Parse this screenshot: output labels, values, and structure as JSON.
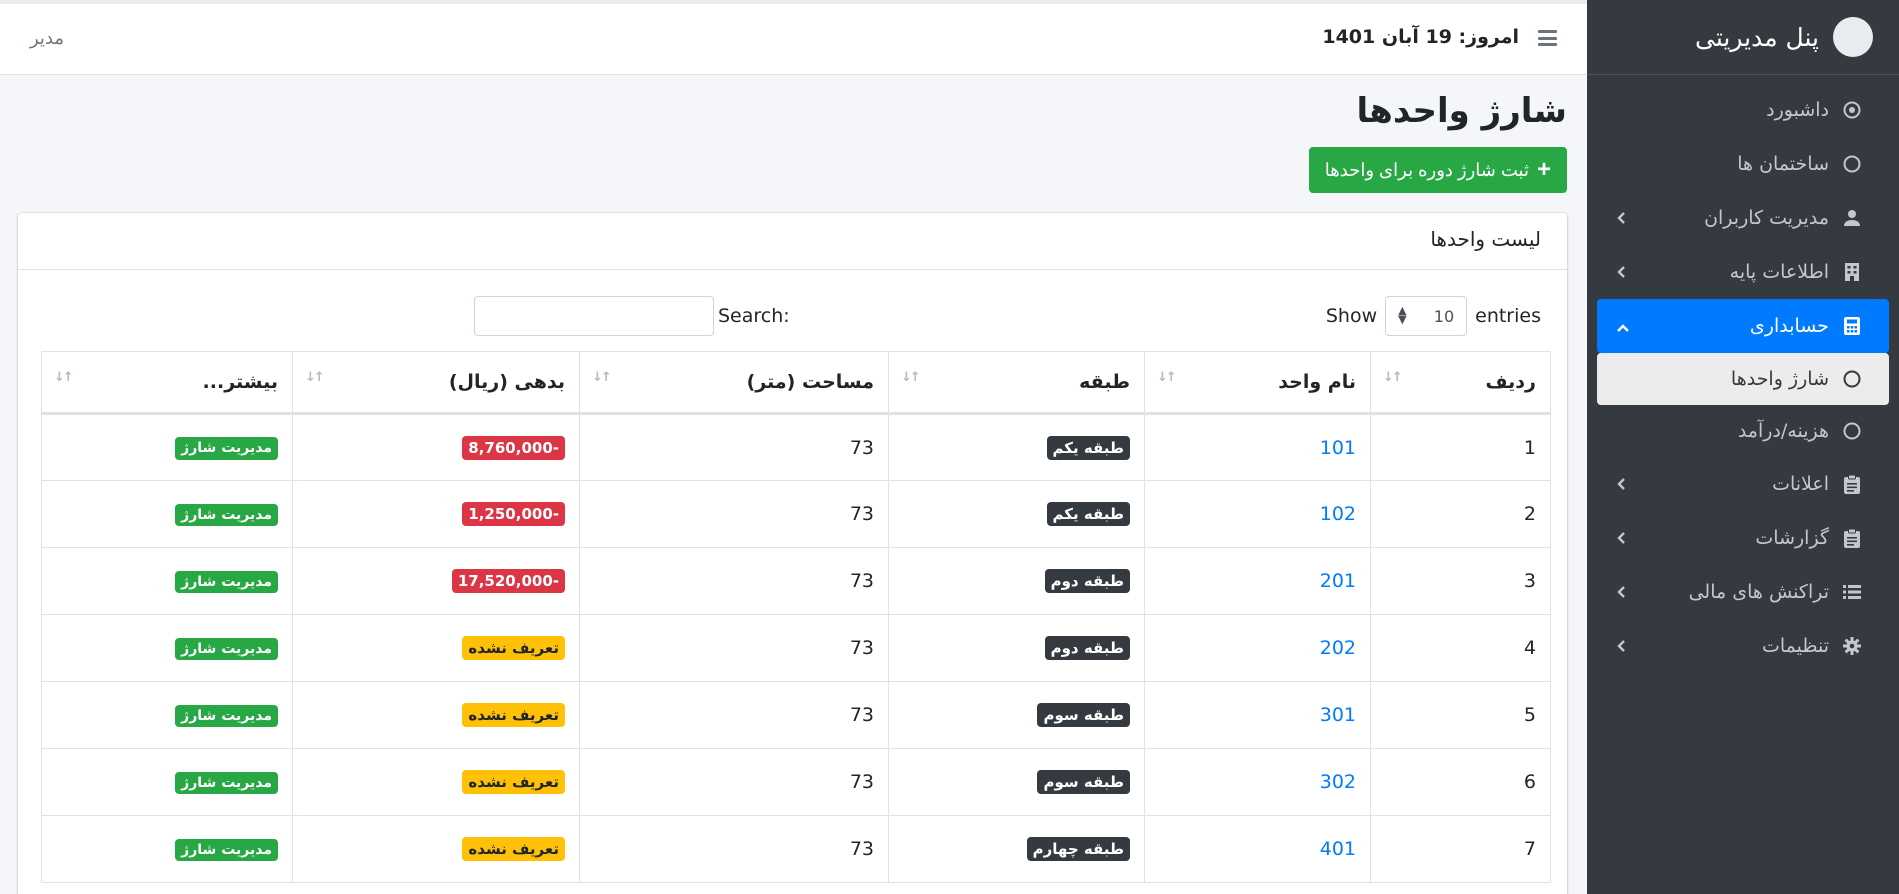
{
  "sidebar": {
    "brand": "پنل مدیریتی",
    "items": [
      {
        "label": "داشبورد",
        "icon": "dashboard-icon",
        "chevron": false
      },
      {
        "label": "ساختمان ها",
        "icon": "circle-icon",
        "chevron": false
      },
      {
        "label": "مدیریت کاربران",
        "icon": "user-icon",
        "chevron": true
      },
      {
        "label": "اطلاعات پایه",
        "icon": "building-icon",
        "chevron": true
      },
      {
        "label": "حسابداری",
        "icon": "calculator-icon",
        "chevron": true
      },
      {
        "label": "شارژ واحدها",
        "icon": "circle-icon",
        "chevron": false
      },
      {
        "label": "هزینه/درآمد",
        "icon": "circle-icon",
        "chevron": false
      },
      {
        "label": "اعلانات",
        "icon": "clipboard-icon",
        "chevron": true
      },
      {
        "label": "گزارشات",
        "icon": "clipboard-icon",
        "chevron": true
      },
      {
        "label": "تراکنش های مالی",
        "icon": "list-icon",
        "chevron": true
      },
      {
        "label": "تنظیمات",
        "icon": "gear-icon",
        "chevron": true
      }
    ]
  },
  "topbar": {
    "today": "امروز: 19 آبان 1401",
    "user": "مدیر"
  },
  "page": {
    "title": "شارژ واحدها",
    "add_button": "ثبت شارژ دوره برای واحدها"
  },
  "card": {
    "title": "لیست واحدها",
    "show_label": "Show",
    "entries_label": "entries",
    "length_value": "10",
    "search_label": "Search:"
  },
  "table": {
    "headers": [
      "ردیف",
      "نام واحد",
      "طبقه",
      "مساحت (متر)",
      "بدهی (ریال)",
      "بیشتر..."
    ],
    "rows": [
      {
        "radif": "1",
        "name": "101",
        "floor": "طبقه یکم",
        "area": "73",
        "debt": "-8,760,000",
        "debt_type": "danger",
        "action": "مدیریت شارژ"
      },
      {
        "radif": "2",
        "name": "102",
        "floor": "طبقه یکم",
        "area": "73",
        "debt": "-1,250,000",
        "debt_type": "danger",
        "action": "مدیریت شارژ"
      },
      {
        "radif": "3",
        "name": "201",
        "floor": "طبقه دوم",
        "area": "73",
        "debt": "-17,520,000",
        "debt_type": "danger",
        "action": "مدیریت شارژ"
      },
      {
        "radif": "4",
        "name": "202",
        "floor": "طبقه دوم",
        "area": "73",
        "debt": "تعریف نشده",
        "debt_type": "warning",
        "action": "مدیریت شارژ"
      },
      {
        "radif": "5",
        "name": "301",
        "floor": "طبقه سوم",
        "area": "73",
        "debt": "تعریف نشده",
        "debt_type": "warning",
        "action": "مدیریت شارژ"
      },
      {
        "radif": "6",
        "name": "302",
        "floor": "طبقه سوم",
        "area": "73",
        "debt": "تعریف نشده",
        "debt_type": "warning",
        "action": "مدیریت شارژ"
      },
      {
        "radif": "7",
        "name": "401",
        "floor": "طبقه چهارم",
        "area": "73",
        "debt": "تعریف نشده",
        "debt_type": "warning",
        "action": "مدیریت شارژ"
      }
    ]
  },
  "colors": {
    "sidebar_bg": "#343a40",
    "primary": "#007bff",
    "success": "#28a745",
    "danger": "#dc3545",
    "warning": "#ffc107"
  }
}
